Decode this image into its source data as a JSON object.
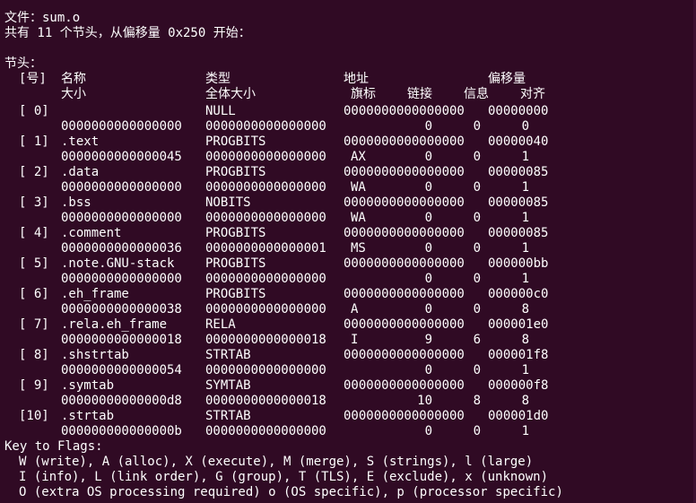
{
  "file_line": "文件：sum.o",
  "summary_line": "共有 11 个节头，从偏移量 0x250 开始：",
  "section_title": "节头：",
  "header": {
    "index": "[号]",
    "name": "名称",
    "type": "类型",
    "address": "地址",
    "offset": "偏移量",
    "size": "大小",
    "entsize": "全体大小",
    "flags": "旗标",
    "link": "链接",
    "info": "信息",
    "align": "对齐"
  },
  "sections": [
    {
      "index": "[ 0]",
      "name": "",
      "type": "NULL",
      "address": "0000000000000000",
      "offset": "00000000",
      "size": "0000000000000000",
      "entsize": "0000000000000000",
      "flags": "",
      "link": "0",
      "info": "0",
      "align": "0"
    },
    {
      "index": "[ 1]",
      "name": ".text",
      "type": "PROGBITS",
      "address": "0000000000000000",
      "offset": "00000040",
      "size": "0000000000000045",
      "entsize": "0000000000000000",
      "flags": "AX",
      "link": "0",
      "info": "0",
      "align": "1"
    },
    {
      "index": "[ 2]",
      "name": ".data",
      "type": "PROGBITS",
      "address": "0000000000000000",
      "offset": "00000085",
      "size": "0000000000000000",
      "entsize": "0000000000000000",
      "flags": "WA",
      "link": "0",
      "info": "0",
      "align": "1"
    },
    {
      "index": "[ 3]",
      "name": ".bss",
      "type": "NOBITS",
      "address": "0000000000000000",
      "offset": "00000085",
      "size": "0000000000000000",
      "entsize": "0000000000000000",
      "flags": "WA",
      "link": "0",
      "info": "0",
      "align": "1"
    },
    {
      "index": "[ 4]",
      "name": ".comment",
      "type": "PROGBITS",
      "address": "0000000000000000",
      "offset": "00000085",
      "size": "0000000000000036",
      "entsize": "0000000000000001",
      "flags": "MS",
      "link": "0",
      "info": "0",
      "align": "1"
    },
    {
      "index": "[ 5]",
      "name": ".note.GNU-stack",
      "type": "PROGBITS",
      "address": "0000000000000000",
      "offset": "000000bb",
      "size": "0000000000000000",
      "entsize": "0000000000000000",
      "flags": "",
      "link": "0",
      "info": "0",
      "align": "1"
    },
    {
      "index": "[ 6]",
      "name": ".eh_frame",
      "type": "PROGBITS",
      "address": "0000000000000000",
      "offset": "000000c0",
      "size": "0000000000000038",
      "entsize": "0000000000000000",
      "flags": "A",
      "link": "0",
      "info": "0",
      "align": "8"
    },
    {
      "index": "[ 7]",
      "name": ".rela.eh_frame",
      "type": "RELA",
      "address": "0000000000000000",
      "offset": "000001e0",
      "size": "0000000000000018",
      "entsize": "0000000000000018",
      "flags": "I",
      "link": "9",
      "info": "6",
      "align": "8"
    },
    {
      "index": "[ 8]",
      "name": ".shstrtab",
      "type": "STRTAB",
      "address": "0000000000000000",
      "offset": "000001f8",
      "size": "0000000000000054",
      "entsize": "0000000000000000",
      "flags": "",
      "link": "0",
      "info": "0",
      "align": "1"
    },
    {
      "index": "[ 9]",
      "name": ".symtab",
      "type": "SYMTAB",
      "address": "0000000000000000",
      "offset": "000000f8",
      "size": "00000000000000d8",
      "entsize": "0000000000000018",
      "flags": "",
      "link": "10",
      "info": "8",
      "align": "8"
    },
    {
      "index": "[10]",
      "name": ".strtab",
      "type": "STRTAB",
      "address": "0000000000000000",
      "offset": "000001d0",
      "size": "000000000000000b",
      "entsize": "0000000000000000",
      "flags": "",
      "link": "0",
      "info": "0",
      "align": "1"
    }
  ],
  "flags_key": {
    "title": "Key to Flags:",
    "lines": [
      "W (write), A (alloc), X (execute), M (merge), S (strings), l (large)",
      "I (info), L (link order), G (group), T (TLS), E (exclude), x (unknown)",
      "O (extra OS processing required) o (OS specific), p (processor specific)"
    ]
  },
  "colors": {
    "background": "#300a24",
    "foreground": "#ffffff"
  }
}
